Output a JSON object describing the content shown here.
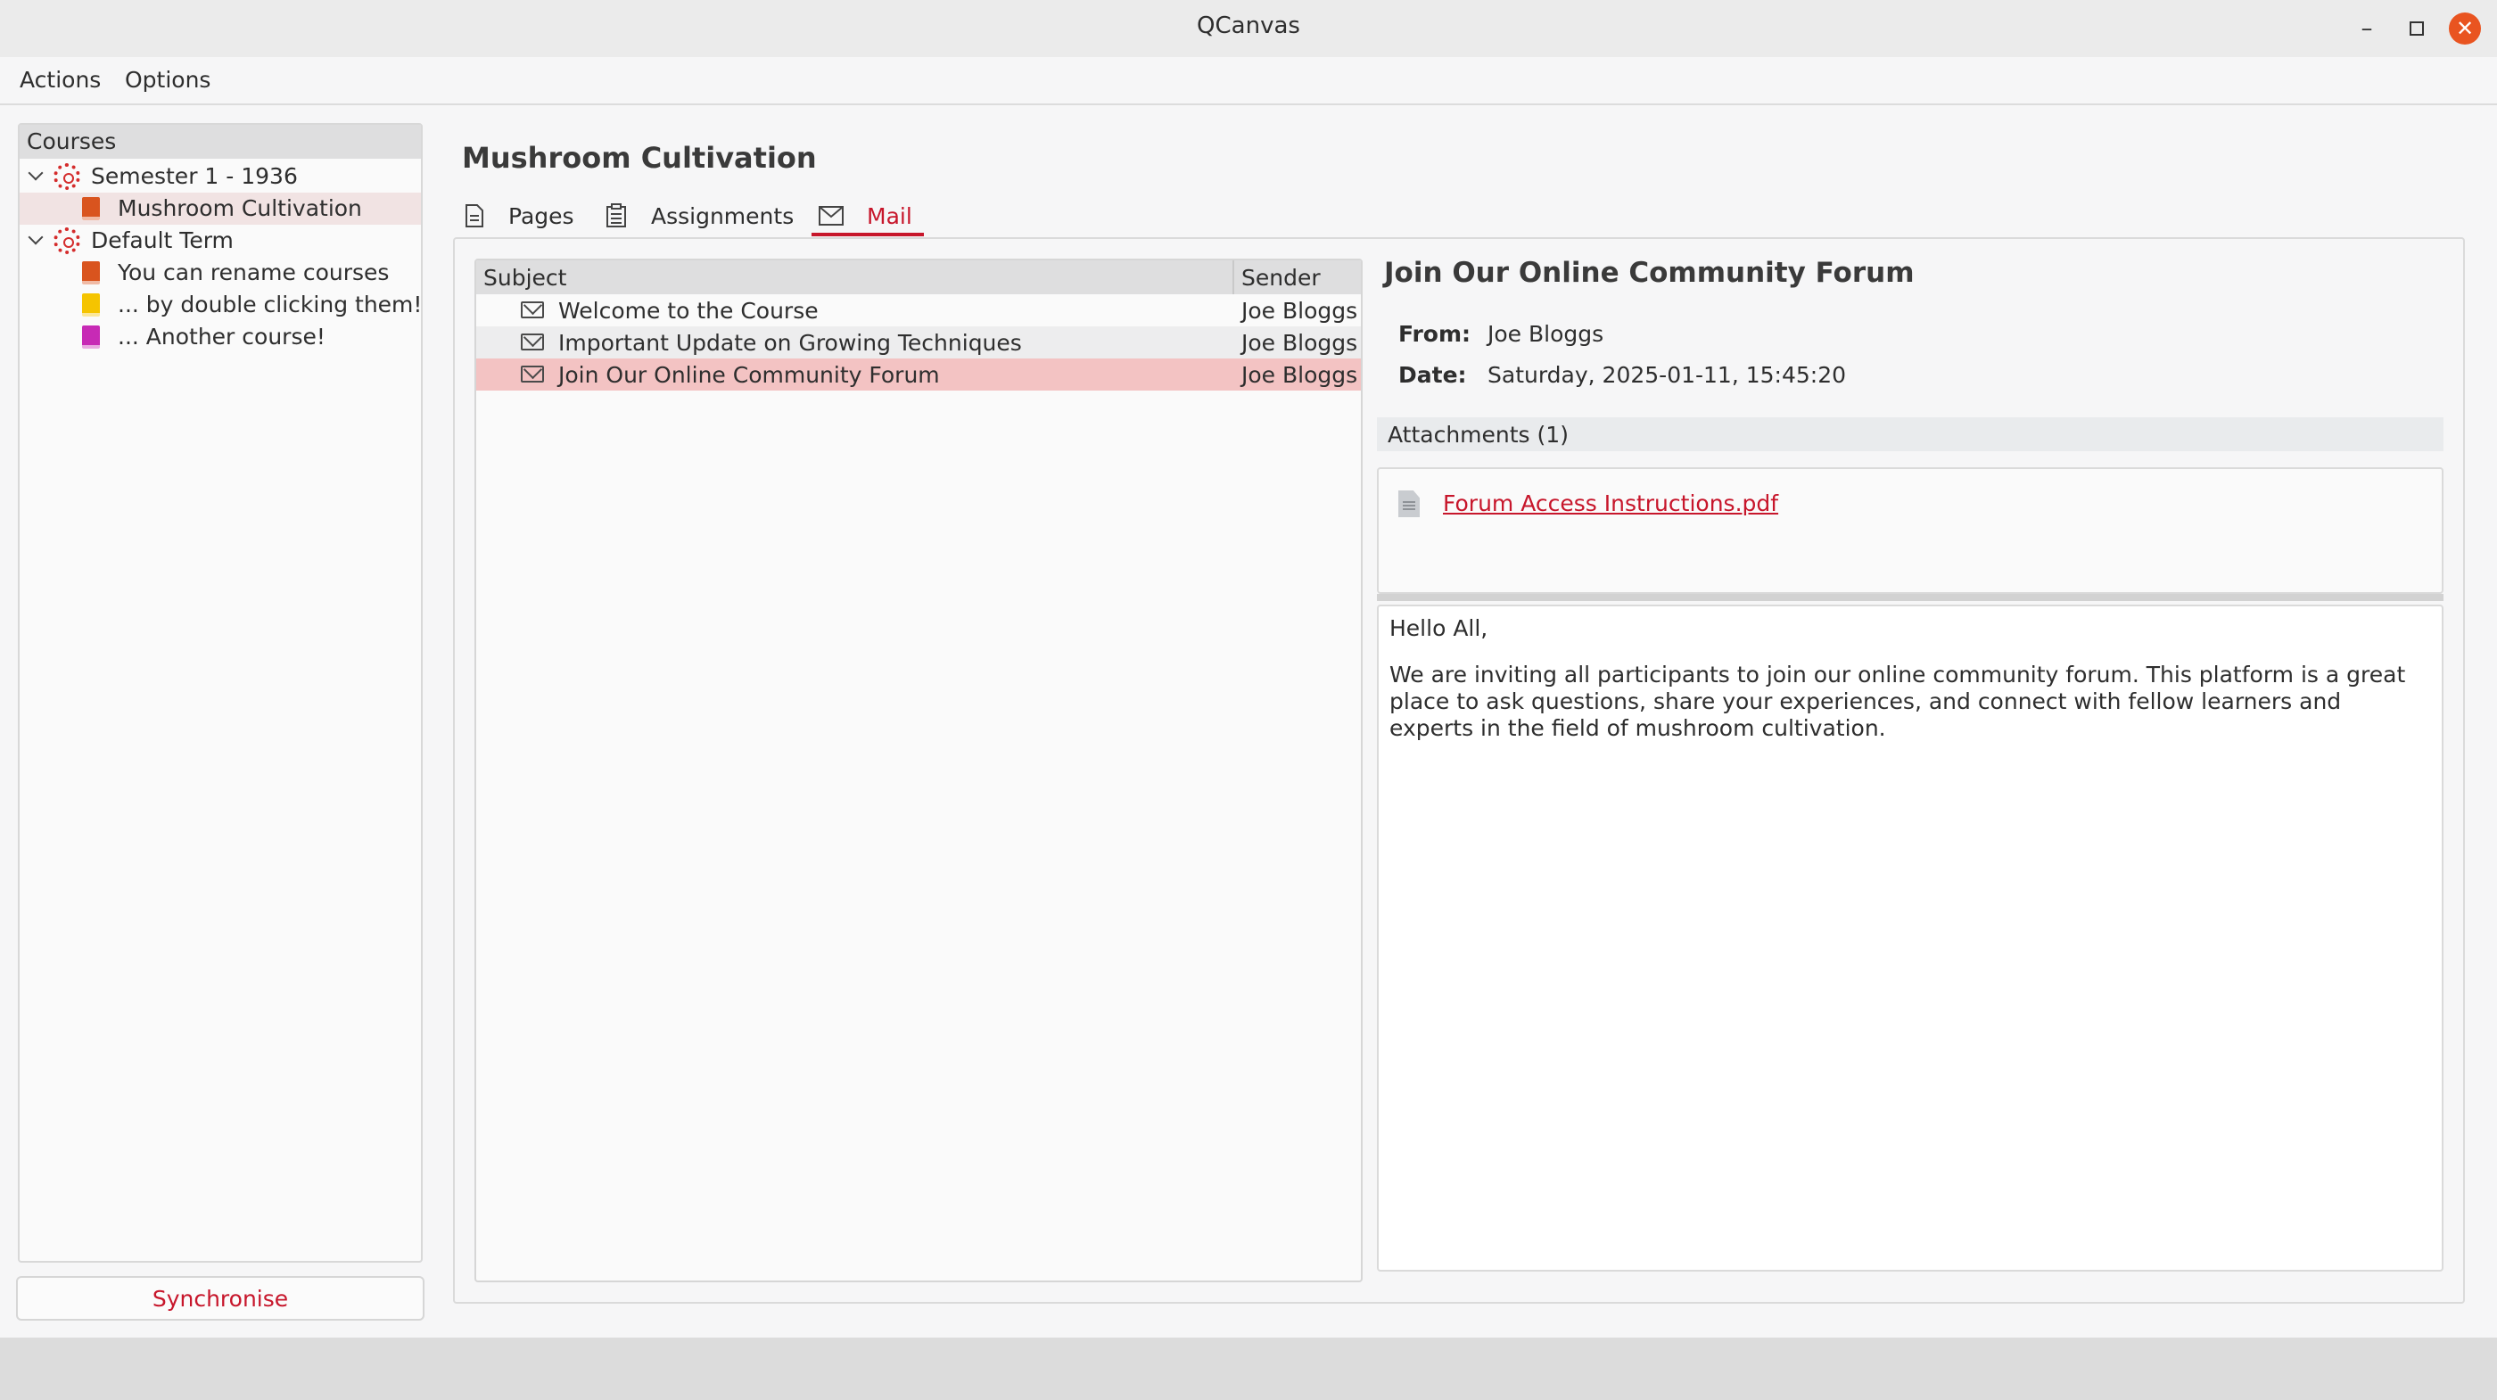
{
  "window": {
    "title": "QCanvas"
  },
  "menu": {
    "actions": "Actions",
    "options": "Options"
  },
  "sidebar": {
    "header": "Courses",
    "terms": [
      {
        "label": "Semester 1 - 1936"
      },
      {
        "label": "Default Term"
      }
    ],
    "courses": [
      {
        "label": "Mushroom Cultivation",
        "color": "#d9541e"
      },
      {
        "label": "You can rename courses",
        "color": "#d9541e"
      },
      {
        "label": "... by double clicking them!",
        "color": "#f5c400"
      },
      {
        "label": "... Another course!",
        "color": "#c72ab5"
      }
    ],
    "sync_label": "Synchronise"
  },
  "course": {
    "title": "Mushroom Cultivation"
  },
  "tabs": [
    {
      "label": "Pages"
    },
    {
      "label": "Assignments"
    },
    {
      "label": "Mail"
    }
  ],
  "mail_list": {
    "columns": {
      "subject": "Subject",
      "sender": "Sender"
    },
    "rows": [
      {
        "subject": "Welcome to the Course",
        "sender": "Joe Bloggs"
      },
      {
        "subject": "Important Update on Growing Techniques",
        "sender": "Joe Bloggs"
      },
      {
        "subject": "Join Our Online Community Forum",
        "sender": "Joe Bloggs"
      }
    ]
  },
  "mail_view": {
    "subject": "Join Our Online Community Forum",
    "from_label": "From:",
    "from_value": "Joe Bloggs",
    "date_label": "Date:",
    "date_value": "Saturday, 2025-01-11, 15:45:20",
    "attachments_header": "Attachments (1)",
    "attachment_name": "Forum Access Instructions.pdf",
    "body_greeting": "Hello All,",
    "body_text": "We are inviting all participants to join our online community forum. This platform is a great place to ask questions, share your experiences, and connect with fellow learners and experts in the field of mushroom cultivation."
  },
  "colors": {
    "accent": "#c7162b",
    "selection": "#f3c3c3",
    "close_button": "#e95420"
  }
}
